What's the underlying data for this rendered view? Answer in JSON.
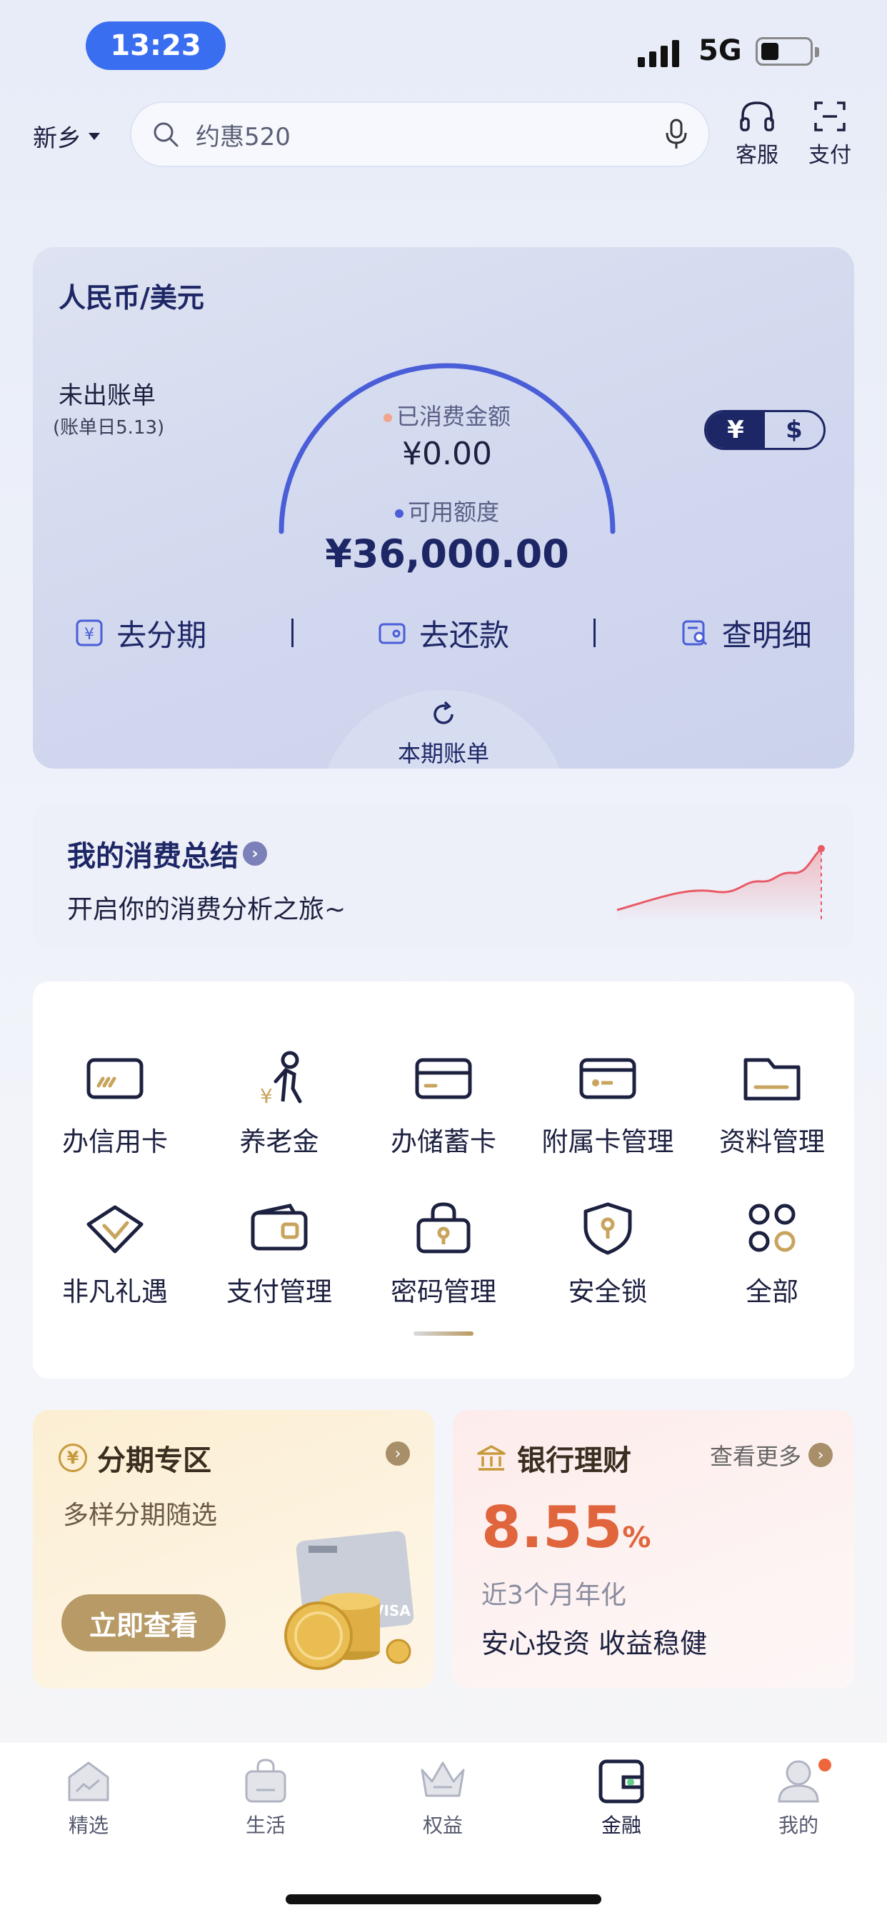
{
  "status_bar": {
    "time": "13:23",
    "network": "5G"
  },
  "header": {
    "city": "新乡",
    "search_placeholder": "约惠520",
    "service_label": "客服",
    "pay_label": "支付"
  },
  "credit_panel": {
    "title": "人民币/美元",
    "unbilled_label": "未出账单",
    "bill_date": "(账单日5.13)",
    "spent_label": "已消费金额",
    "spent_value": "¥0.00",
    "available_label": "可用额度",
    "available_value": "¥36,000.00",
    "currency_cny": "¥",
    "currency_usd": "$",
    "actions": [
      "去分期",
      "去还款",
      "查明细"
    ],
    "current_bill_label": "本期账单",
    "colors": {
      "arc": "#4a5ed8",
      "spent_dot": "#f2a58a",
      "available_dot": "#4a5ed8"
    }
  },
  "summary": {
    "title": "我的消费总结",
    "subtitle": "开启你的消费分析之旅~"
  },
  "services": [
    {
      "label": "办信用卡",
      "icon": "credit-card-icon"
    },
    {
      "label": "养老金",
      "icon": "pension-icon"
    },
    {
      "label": "办储蓄卡",
      "icon": "debit-card-icon"
    },
    {
      "label": "附属卡管理",
      "icon": "supplementary-card-icon"
    },
    {
      "label": "资料管理",
      "icon": "folder-icon"
    },
    {
      "label": "非凡礼遇",
      "icon": "gift-diamond-icon"
    },
    {
      "label": "支付管理",
      "icon": "wallet-icon"
    },
    {
      "label": "密码管理",
      "icon": "lock-icon"
    },
    {
      "label": "安全锁",
      "icon": "shield-icon"
    },
    {
      "label": "全部",
      "icon": "all-apps-icon"
    }
  ],
  "promo_installment": {
    "title": "分期专区",
    "subtitle": "多样分期随选",
    "button": "立即查看"
  },
  "promo_wealth": {
    "title": "银行理财",
    "more": "查看更多",
    "rate": "8.55",
    "rate_unit": "%",
    "rate_label": "近3个月年化",
    "slogan": "安心投资 收益稳健",
    "rate_color": "#e0643c"
  },
  "tabs": [
    {
      "label": "精选",
      "icon": "home-icon"
    },
    {
      "label": "生活",
      "icon": "bag-icon"
    },
    {
      "label": "权益",
      "icon": "crown-icon"
    },
    {
      "label": "金融",
      "icon": "wallet-icon"
    },
    {
      "label": "我的",
      "icon": "profile-icon"
    }
  ]
}
